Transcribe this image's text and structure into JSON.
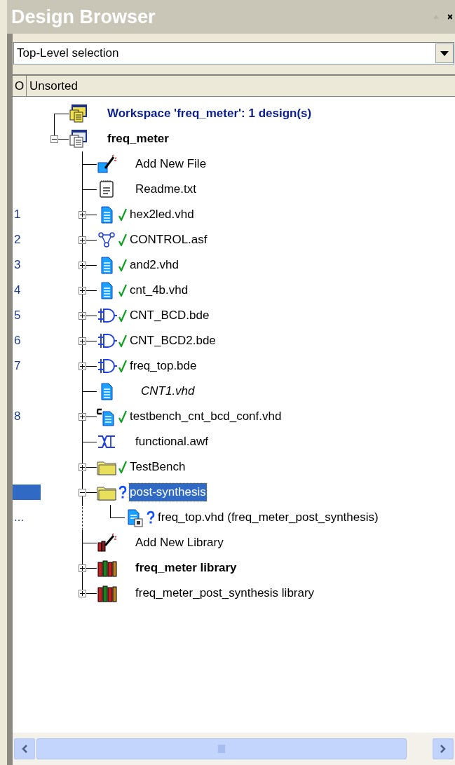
{
  "window": {
    "title": "Design Browser"
  },
  "dropdown": {
    "value": "Top-Level selection"
  },
  "columns": [
    "O",
    "Unsorted"
  ],
  "tree": [
    {
      "label": "Workspace 'freq_meter': 1 design(s)",
      "kind": "workspace",
      "emphasized": true,
      "selected": false
    },
    {
      "label": "freq_meter",
      "kind": "design",
      "emphasized": true,
      "expanded": true,
      "selected": false,
      "children": [
        {
          "label": "Add New File",
          "kind": "wizard",
          "selected": false
        },
        {
          "label": "Readme.txt",
          "kind": "text",
          "selected": false
        },
        {
          "order": "1",
          "label": "hex2led.vhd",
          "kind": "vhdl",
          "compiled": true,
          "expanded": false,
          "selected": false
        },
        {
          "order": "2",
          "label": "CONTROL.asf",
          "kind": "state",
          "compiled": true,
          "expanded": false,
          "selected": false
        },
        {
          "order": "3",
          "label": "and2.vhd",
          "kind": "vhdl",
          "compiled": true,
          "expanded": false,
          "selected": false
        },
        {
          "order": "4",
          "label": "cnt_4b.vhd",
          "kind": "vhdl",
          "compiled": true,
          "expanded": false,
          "selected": false
        },
        {
          "order": "5",
          "label": "CNT_BCD.bde",
          "kind": "block",
          "compiled": true,
          "expanded": false,
          "selected": false
        },
        {
          "order": "6",
          "label": "CNT_BCD2.bde",
          "kind": "block",
          "compiled": true,
          "expanded": false,
          "selected": false
        },
        {
          "order": "7",
          "label": "freq_top.bde",
          "kind": "block",
          "compiled": true,
          "expanded": false,
          "selected": false
        },
        {
          "label": "CNT1.vhd",
          "kind": "vhdl",
          "excluded": true,
          "selected": false
        },
        {
          "order": "8",
          "label": "testbench_cnt_bcd_conf.vhd",
          "kind": "config",
          "compiled": true,
          "expanded": false,
          "selected": false
        },
        {
          "label": "functional.awf",
          "kind": "wave",
          "selected": false
        },
        {
          "label": "TestBench",
          "kind": "folder",
          "compiled": true,
          "expanded": false,
          "selected": false
        },
        {
          "label": "post-synthesis",
          "kind": "folder",
          "compiled": false,
          "expanded": true,
          "selected": true,
          "children": [
            {
              "order": "...",
              "label": "freq_top.vhd (freq_meter_post_synthesis)",
              "kind": "netlist",
              "compiled": false,
              "selected": false
            }
          ]
        },
        {
          "label": "Add New Library",
          "kind": "library-wizard",
          "selected": false
        },
        {
          "label": "freq_meter library",
          "kind": "library",
          "emphasized": true,
          "expanded": false,
          "selected": false
        },
        {
          "label": "freq_meter_post_synthesis library",
          "kind": "library",
          "expanded": false,
          "selected": false
        }
      ]
    }
  ]
}
